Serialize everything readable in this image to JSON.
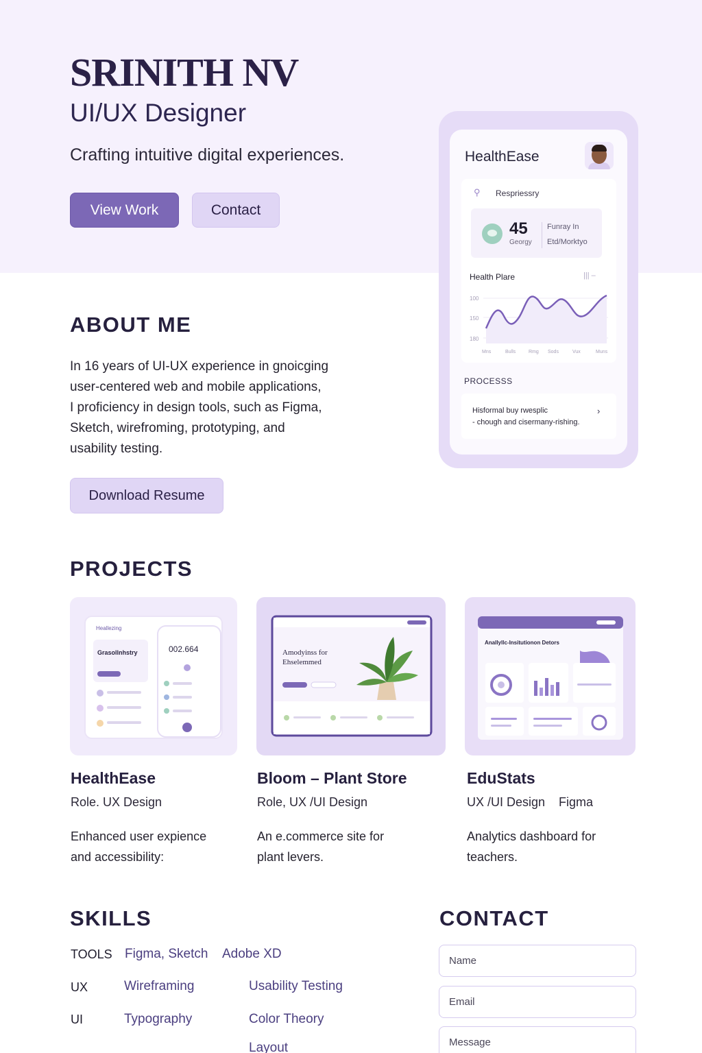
{
  "hero": {
    "name": "SRINITH NV",
    "role": "UI/UX Designer",
    "tagline": "Crafting intuitive digital experiences.",
    "view_work_label": "View Work",
    "contact_label": "Contact"
  },
  "phone": {
    "app_title": "HealthEase",
    "resp_label": "Respriessry",
    "stat_value": "45",
    "stat_sub": "Georgy",
    "stat_right_1": "Funray In",
    "stat_right_2": "Etd/Morktyo",
    "chart_title": "Health Plare",
    "chart_y_labels": [
      "100",
      "150",
      "180"
    ],
    "chart_x_labels": [
      "Mns",
      "Bulls",
      "Rmg",
      "Sods",
      "Vux",
      "Muns"
    ],
    "process_label": "PROCESSS",
    "process_line1": "Hisformal buy rwesplic",
    "process_line2": "- chough and cisermany-rishing."
  },
  "about": {
    "title": "ABOUT ME",
    "lines": [
      "In 16 years of UI-UX experience in gnoicging",
      "user-centered web and mobile applications,",
      "I proficiency in design tools, such as Figma,",
      "Sketch, wirefroming, prototyping, and",
      "usability testing."
    ],
    "resume_label": "Download Resume"
  },
  "projects": {
    "title": "PROJECTS",
    "items": [
      {
        "title": "HealthEase",
        "role": "Role. UX Design",
        "desc": "Enhanced user expience and accessibility:",
        "thumb_app": "Heallezing",
        "thumb_heading": "Grasollnhstry",
        "thumb_number": "002.664"
      },
      {
        "title": "Bloom – Plant Store",
        "role": "Role, UX /UI Design",
        "desc": "An e.commerce site for plant levers.",
        "thumb_heading_1": "Amodyinss for",
        "thumb_heading_2": "Ehselemmed"
      },
      {
        "title": "EduStats",
        "role": "UX /UI Design    Figma",
        "desc": "Analytics dashboard for teachers.",
        "thumb_heading": "Anallyllc-Insitutionon Detors"
      }
    ]
  },
  "skills": {
    "title": "SKILLS",
    "tools_label": "TOOLS",
    "tools_1": "Figma, Sketch",
    "tools_2": "Adobe XD",
    "ux_label": "UX",
    "ux_1": "Wireframing",
    "ux_2": "Usability Testing",
    "ui_label": "UI",
    "ui_1": "Typography",
    "ui_2": "Color Theory",
    "ui_3": "Layout"
  },
  "contact": {
    "title": "CONTACT",
    "name_placeholder": "Name",
    "email_placeholder": "Email",
    "message_placeholder": "Message"
  },
  "colors": {
    "accent": "#7c68b6",
    "accent_light": "#e0d6f5",
    "hero_bg": "#f6f1fd",
    "heading": "#26203e"
  },
  "phone_chart_data": {
    "type": "line",
    "y_tick_labels": [
      "100",
      "150",
      "180"
    ],
    "x_tick_labels": [
      "Mns",
      "Bulls",
      "Rmg",
      "Sods",
      "Vux",
      "Muns"
    ]
  }
}
